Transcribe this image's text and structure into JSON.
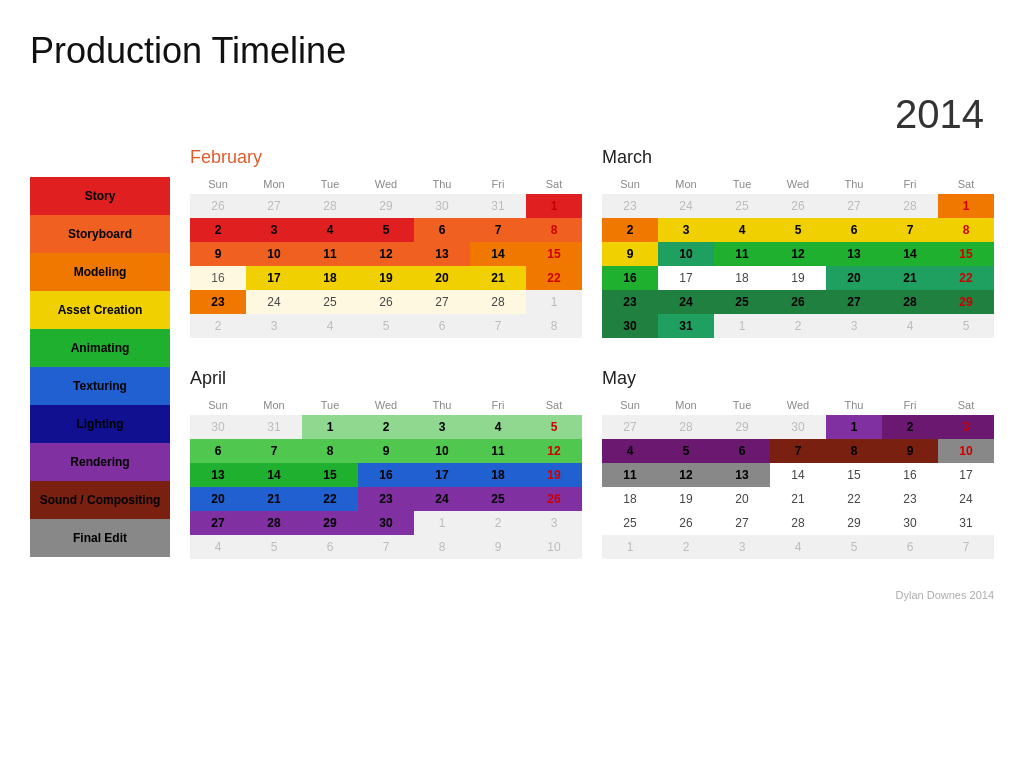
{
  "title": "Production Timeline",
  "year": "2014",
  "legend": [
    {
      "label": "Story",
      "color": "#e02020"
    },
    {
      "label": "Storyboard",
      "color": "#f06020"
    },
    {
      "label": "Modeling",
      "color": "#f07800"
    },
    {
      "label": "Asset Creation",
      "color": "#f0d000"
    },
    {
      "label": "Animating",
      "color": "#20b030"
    },
    {
      "label": "Texturing",
      "color": "#2060d0"
    },
    {
      "label": "Lighting",
      "color": "#101090"
    },
    {
      "label": "Rendering",
      "color": "#8030a0"
    },
    {
      "label": "Sound / Compositing",
      "color": "#7a2010"
    },
    {
      "label": "Final Edit",
      "color": "#888888"
    }
  ],
  "footer": "Dylan Downes 2014",
  "calendars": {
    "february": {
      "title": "February",
      "days": [
        "Sun",
        "Mon",
        "Tue",
        "Wed",
        "Thu",
        "Fri",
        "Sat"
      ]
    },
    "march": {
      "title": "March",
      "days": [
        "Sun",
        "Mon",
        "Tue",
        "Wed",
        "Thu",
        "Fri",
        "Sat"
      ]
    },
    "april": {
      "title": "April",
      "days": [
        "Sun",
        "Mon",
        "Tue",
        "Wed",
        "Thu",
        "Fri",
        "Sat"
      ]
    },
    "may": {
      "title": "May",
      "days": [
        "Sun",
        "Mon",
        "Tue",
        "Wed",
        "Thu",
        "Fri",
        "Sat"
      ]
    }
  }
}
